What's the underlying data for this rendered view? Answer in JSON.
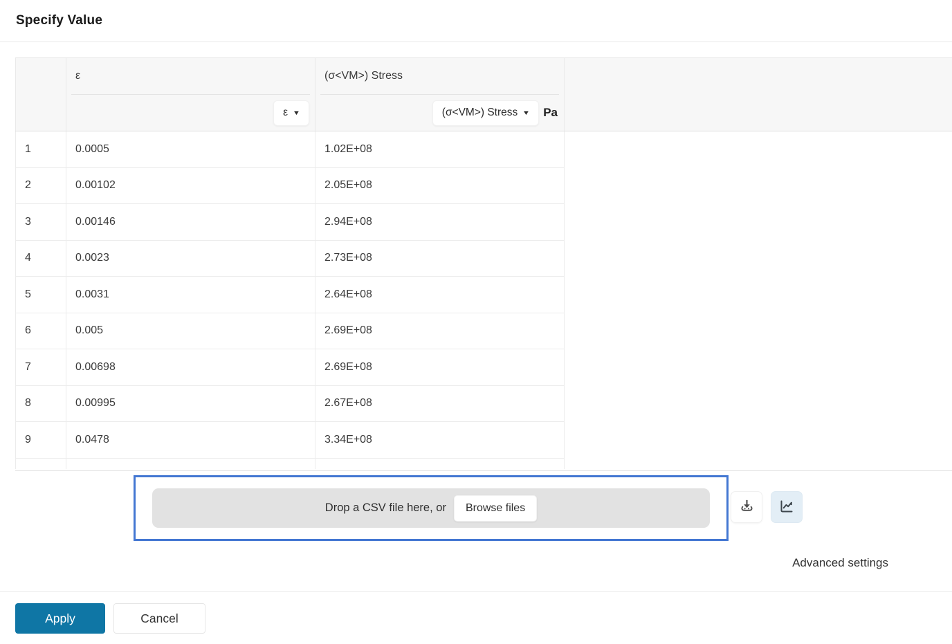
{
  "titlebar": {
    "title": "Specify Value"
  },
  "table": {
    "columns": [
      {
        "label": "ε",
        "dropdown_label": "ε",
        "unit": ""
      },
      {
        "label": "(σ<VM>) Stress",
        "dropdown_label": "(σ<VM>) Stress",
        "unit": "Pa"
      }
    ],
    "rows": [
      {
        "index": "1",
        "epsilon": "0.0005",
        "stress": "1.02E+08"
      },
      {
        "index": "2",
        "epsilon": "0.00102",
        "stress": "2.05E+08"
      },
      {
        "index": "3",
        "epsilon": "0.00146",
        "stress": "2.94E+08"
      },
      {
        "index": "4",
        "epsilon": "0.0023",
        "stress": "2.73E+08"
      },
      {
        "index": "5",
        "epsilon": "0.0031",
        "stress": "2.64E+08"
      },
      {
        "index": "6",
        "epsilon": "0.005",
        "stress": "2.69E+08"
      },
      {
        "index": "7",
        "epsilon": "0.00698",
        "stress": "2.69E+08"
      },
      {
        "index": "8",
        "epsilon": "0.00995",
        "stress": "2.67E+08"
      },
      {
        "index": "9",
        "epsilon": "0.0478",
        "stress": "3.34E+08"
      }
    ]
  },
  "dropzone": {
    "text": "Drop a CSV file here, or",
    "browse_label": "Browse files"
  },
  "actions": {
    "advanced_settings_label": "Advanced settings",
    "apply_label": "Apply",
    "cancel_label": "Cancel"
  },
  "icons": {
    "caret": "▼",
    "download": "download-icon",
    "chart": "line-chart-icon"
  },
  "colors": {
    "primary_button": "#0f76a5",
    "dropzone_border": "#4377d2",
    "chart_button_bg": "#e3eef6",
    "header_band_bg": "#f7f7f7"
  }
}
